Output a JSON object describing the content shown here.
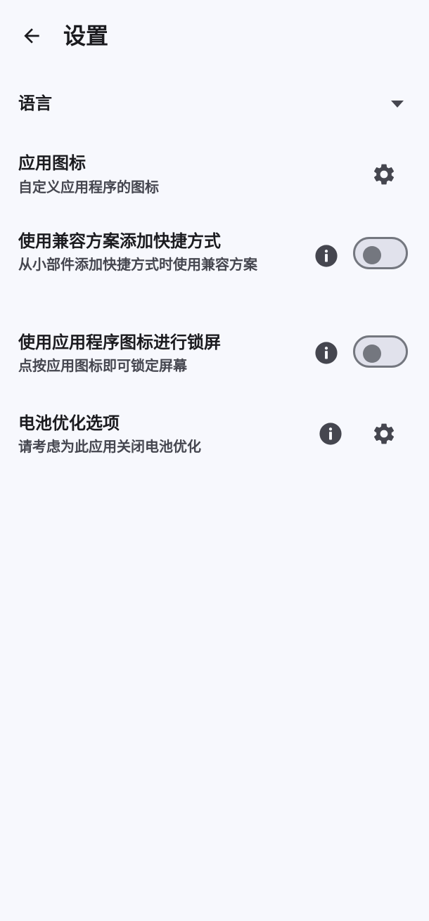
{
  "header": {
    "title": "设置",
    "back_icon": "arrow-back-icon"
  },
  "language": {
    "label": "语言",
    "dropdown_icon": "dropdown-arrow-icon"
  },
  "app_icon": {
    "title": "应用图标",
    "subtitle": "自定义应用程序的图标",
    "action_icon": "gear-icon"
  },
  "compat_shortcut": {
    "title": "使用兼容方案添加快捷方式",
    "subtitle": "从小部件添加快捷方式时使用兼容方案",
    "info_icon": "info-icon",
    "toggle_on": false
  },
  "lock_screen": {
    "title": "使用应用程序图标进行锁屏",
    "subtitle": "点按应用图标即可锁定屏幕",
    "info_icon": "info-icon",
    "toggle_on": false
  },
  "battery": {
    "title": "电池优化选项",
    "subtitle": "请考虑为此应用关闭电池优化",
    "info_icon": "info-icon",
    "action_icon": "gear-icon"
  },
  "colors": {
    "background": "#f7f8fd",
    "text_primary": "#1b1b1f",
    "text_secondary": "#45464f",
    "icon": "#45464f",
    "toggle_track": "#e1e2ec",
    "toggle_outline": "#74777f"
  }
}
